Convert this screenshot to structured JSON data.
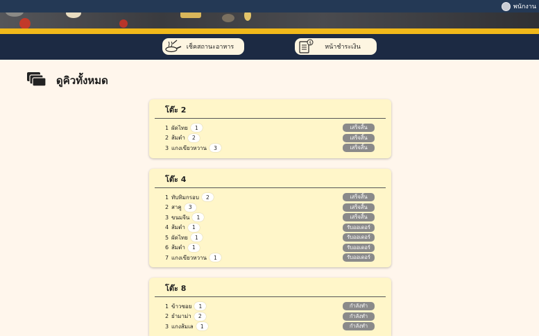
{
  "header": {
    "user_name": "พนักงาน"
  },
  "nav": {
    "buttons": [
      {
        "label": "เช็คสถานะอาหาร",
        "icon": "cooking-pan-icon"
      },
      {
        "label": "หน้าชำระเงิน",
        "icon": "receipt-icon"
      }
    ]
  },
  "page": {
    "title": "ดูคิวทั้งหมด",
    "title_icon": "stacked-cards-icon"
  },
  "tables": [
    {
      "title": "โต๊ะ 2",
      "orders": [
        {
          "index": "1",
          "name": "ผัดไทย",
          "qty": "1",
          "status": "เสร็จสิ้น"
        },
        {
          "index": "2",
          "name": "ส้มตำ",
          "qty": "2",
          "status": "เสร็จสิ้น"
        },
        {
          "index": "3",
          "name": "แกงเขียวหวาน",
          "qty": "3",
          "status": "เสร็จสิ้น"
        }
      ]
    },
    {
      "title": "โต๊ะ 4",
      "orders": [
        {
          "index": "1",
          "name": "ทับทิมกรอบ",
          "qty": "2",
          "status": "เสร็จสิ้น"
        },
        {
          "index": "2",
          "name": "สาคู",
          "qty": "3",
          "status": "เสร็จสิ้น"
        },
        {
          "index": "3",
          "name": "ขนมจีน",
          "qty": "1",
          "status": "เสร็จสิ้น"
        },
        {
          "index": "4",
          "name": "ส้มตำ",
          "qty": "1",
          "status": "รับออเดอร์"
        },
        {
          "index": "5",
          "name": "ผัดไทย",
          "qty": "1",
          "status": "รับออเดอร์"
        },
        {
          "index": "6",
          "name": "ส้มตำ",
          "qty": "1",
          "status": "รับออเดอร์"
        },
        {
          "index": "7",
          "name": "แกงเขียวหวาน",
          "qty": "1",
          "status": "รับออเดอร์"
        }
      ]
    },
    {
      "title": "โต๊ะ 8",
      "orders": [
        {
          "index": "1",
          "name": "ข้าวซอย",
          "qty": "1",
          "status": "กำลังทำ"
        },
        {
          "index": "2",
          "name": "ยำมาม่า",
          "qty": "2",
          "status": "กำลังทำ"
        },
        {
          "index": "3",
          "name": "แกงส้มเล",
          "qty": "1",
          "status": "กำลังทำ"
        }
      ]
    }
  ],
  "colors": {
    "topbar": "#243955",
    "navbar": "#1c2a43",
    "accent_stripe": "#f0b81a",
    "card_bg": "#fff6c9",
    "status_badge": "#8a8a8a",
    "page_bg": "#fff6ec"
  }
}
